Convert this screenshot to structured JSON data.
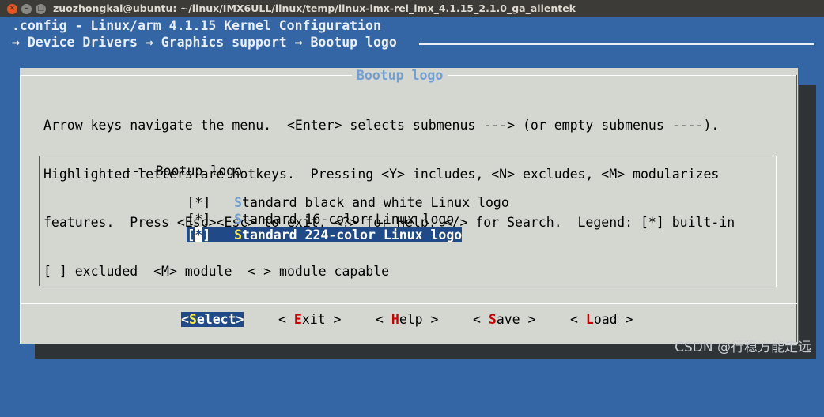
{
  "window": {
    "title": "zuozhongkai@ubuntu: ~/linux/IMX6ULL/linux/temp/linux-imx-rel_imx_4.1.15_2.1.0_ga_alientek",
    "close_glyph": "✕",
    "min_glyph": "–",
    "max_glyph": "□"
  },
  "header": {
    "config_line": ".config - Linux/arm 4.1.15 Kernel Configuration",
    "breadcrumb": "→ Device Drivers → Graphics support → Bootup logo"
  },
  "dialog": {
    "title": "Bootup logo",
    "help_lines": [
      "Arrow keys navigate the menu.  <Enter> selects submenus ---> (or empty submenus ----).",
      "Highlighted letters are hotkeys.  Pressing <Y> includes, <N> excludes, <M> modularizes",
      "features.  Press <Esc><Esc> to exit, <?> for Help, </> for Search.  Legend: [*] built-in",
      "[ ] excluded  <M> module  < > module capable"
    ]
  },
  "menu": {
    "header_item": "--- Bootup logo",
    "items": [
      {
        "check": "[*]",
        "hotkey": "S",
        "rest": "tandard black and white Linux logo",
        "selected": false
      },
      {
        "check": "[*]",
        "hotkey": "S",
        "rest": "tandard 16-color Linux logo",
        "selected": false
      },
      {
        "check_open": "[",
        "check_mark": "*",
        "check_close": "]",
        "hotkey": "S",
        "rest": "tandard 224-color Linux logo",
        "selected": true
      }
    ]
  },
  "buttons": {
    "select": {
      "open": "<",
      "hotkey": "S",
      "rest": "elect",
      "close": ">"
    },
    "exit": {
      "open": "< ",
      "hotkey": "E",
      "rest": "xit",
      "close": " >"
    },
    "help": {
      "open": "< ",
      "hotkey": "H",
      "rest": "elp",
      "close": " >"
    },
    "save": {
      "open": "< ",
      "hotkey": "S",
      "rest": "ave",
      "close": " >"
    },
    "load": {
      "open": "< ",
      "hotkey": "L",
      "rest": "oad",
      "close": " >"
    }
  },
  "watermark": "CSDN @行稳方能走远"
}
